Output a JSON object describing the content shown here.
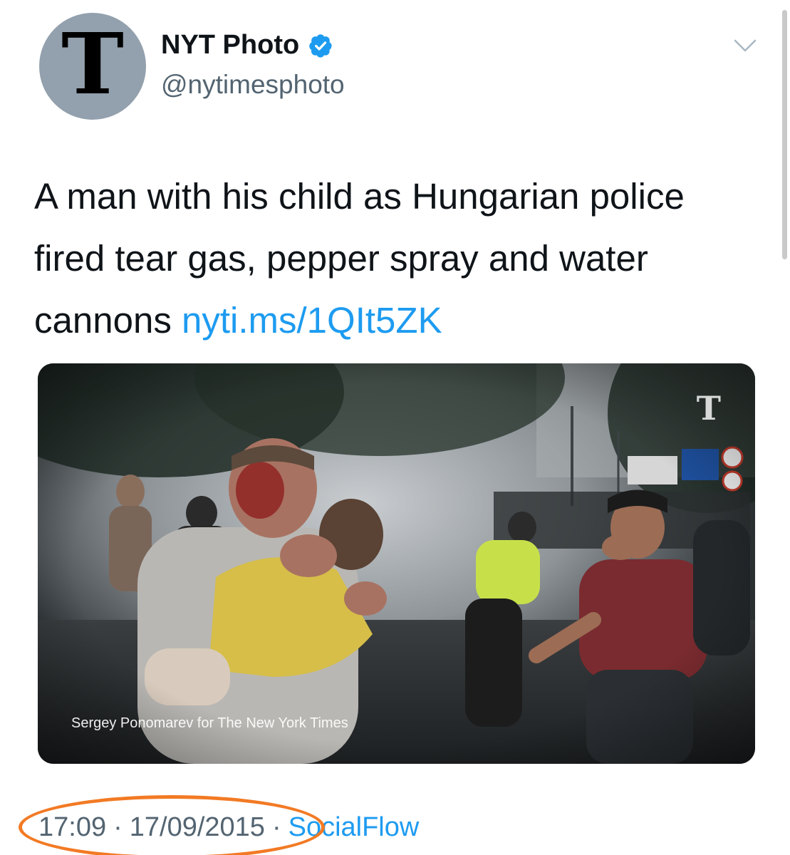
{
  "author": {
    "display_name": "NYT Photo",
    "handle": "@nytimesphoto",
    "avatar_letter": "T",
    "verified": true
  },
  "tweet": {
    "text": "A man with his child as Hungarian police fired tear gas, pepper spray and water cannons ",
    "link": "nyti.ms/1QIt5ZK"
  },
  "media": {
    "logo_letter": "T",
    "credit": "Sergey Ponomarev for The New York Times"
  },
  "meta": {
    "time": "17:09",
    "separator": "·",
    "date": "17/09/2015",
    "source": "SocialFlow"
  },
  "icons": {
    "verified": "verified-badge-icon",
    "more": "chevron-down-icon"
  },
  "colors": {
    "link": "#1d9bf0",
    "muted": "#536471",
    "verified": "#1d9bf0",
    "highlight": "#f27a24"
  }
}
